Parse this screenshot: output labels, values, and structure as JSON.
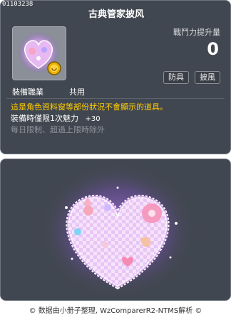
{
  "item": {
    "id": "01103238",
    "title": "古典管家披风",
    "power_label": "戰鬥力提升量",
    "power_value": "0",
    "tags": [
      "防具",
      "披風"
    ],
    "job_label": "裝備職業",
    "job_value": "共用",
    "warning": "這是角色資料窗等部份狀況不會顯示的道具。",
    "charm_label": "裝備時僅限1次魅力",
    "charm_value": "+30",
    "limit_text": "每日限制、超過上限時除外",
    "icon": "heart-cape-icon"
  },
  "preview": {
    "image": "heart-cape-preview"
  },
  "footer": {
    "text": "© 数据由小册子整理, WzComparerR2-NTMS解析 ©"
  },
  "colors": {
    "panel_bg": "#414750",
    "warning": "#ffcc00",
    "muted": "#8e939b"
  }
}
